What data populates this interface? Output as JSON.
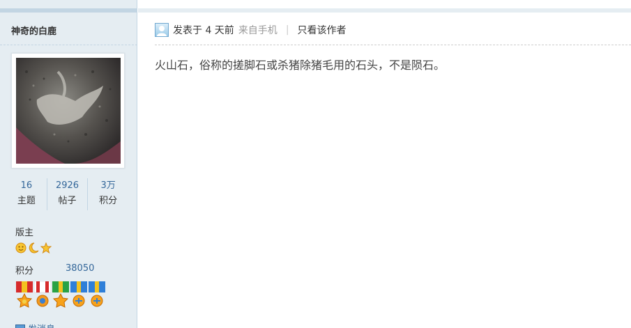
{
  "sidebar": {
    "username": "神奇的白鹿",
    "stats": [
      {
        "value": "16",
        "label": "主题"
      },
      {
        "value": "2926",
        "label": "帖子"
      },
      {
        "value": "3万",
        "label": "积分"
      }
    ],
    "rank_title": "版主",
    "rank_icons": [
      "sun-face-icon",
      "moon-icon",
      "star-icon"
    ],
    "points_label": "积分",
    "points_value": "38050",
    "medals": [
      "medal-red-icon",
      "medal-red-white-icon",
      "medal-green-icon",
      "medal-blue-icon",
      "medal-blue-icon"
    ],
    "bottom_partial": "发消息"
  },
  "post": {
    "posted_label": "发表于 4 天前",
    "from_mobile": "来自手机",
    "separator": "|",
    "only_author": "只看该作者",
    "body": "火山石，俗称的搓脚石或杀猪除猪毛用的石头，不是陨石。"
  },
  "colors": {
    "sidebar_bg": "#e5edf2",
    "border": "#c2d5e3",
    "link_blue": "#336699"
  }
}
